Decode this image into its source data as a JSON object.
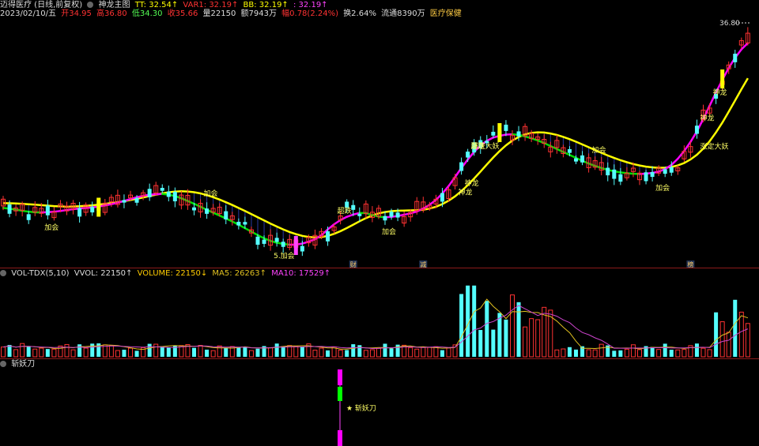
{
  "header": {
    "stock_title": "迈得医疗 (日线,前复权)",
    "indicator_name": "神龙主图",
    "tt": "TT: 32.54↑",
    "var1": "VAR1: 32.19↑",
    "bb": "BB: 32.19↑",
    "extra": ": 32.19↑",
    "date": "2023/02/10/五",
    "open": "开34.95",
    "high": "高36.80",
    "low": "低34.30",
    "close": "收35.66",
    "volume": "量22150",
    "amount": "额7943万",
    "change": "幅0.78(2.24%)",
    "turnover": "换2.64%",
    "float": "流通8390万",
    "sector": "医疗保健"
  },
  "volume_panel": {
    "name": "VOL-TDX(5,10)",
    "vvol": "VVOL: 22150↑",
    "volume": "VOLUME: 22150↓",
    "ma5": "MA5: 26263↑",
    "ma10": "MA10: 17529↑"
  },
  "third_panel": {
    "name": "斩妖刀",
    "label": "★ 斩妖刀"
  },
  "colors": {
    "up": "#ff3232",
    "down": "#54ffff",
    "line_yellow": "#ffff00",
    "line_green": "#00dd00",
    "line_magenta": "#ff00ff",
    "fill_blue": "#2a3aa0",
    "fill_red": "#aa2a2a",
    "signal_yellow": "#ffff33",
    "ma5": "#e0c020",
    "ma10": "#cc44cc"
  },
  "chart_data": {
    "type": "candlestick",
    "price_high_label": "36.80",
    "annotations": [
      {
        "text": "加会",
        "index": 6
      },
      {
        "text": "加会",
        "index": 31
      },
      {
        "text": "5.加会",
        "index": 42
      },
      {
        "text": "超跌",
        "index": 52
      },
      {
        "text": "加会",
        "index": 59
      },
      {
        "text": "超跌",
        "index": 73
      },
      {
        "text": "神龙",
        "index": 72
      },
      {
        "text": "涨定大妖",
        "index": 73
      },
      {
        "text": "神龙",
        "index": 71
      },
      {
        "text": "加会",
        "index": 92
      },
      {
        "text": "加会",
        "index": 102
      },
      {
        "text": "神龙",
        "index": 109
      },
      {
        "text": "涨定大妖",
        "index": 109
      },
      {
        "text": "神龙",
        "index": 111
      }
    ],
    "markers": [
      {
        "text": "财",
        "index": 55
      },
      {
        "text": "减",
        "index": 66
      },
      {
        "text": "榜",
        "index": 108
      }
    ]
  }
}
